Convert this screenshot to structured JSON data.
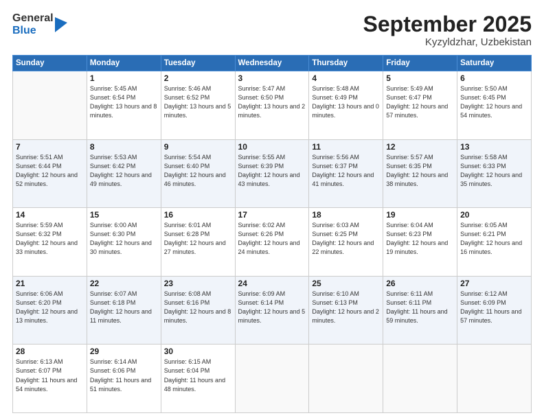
{
  "logo": {
    "general": "General",
    "blue": "Blue"
  },
  "header": {
    "month": "September 2025",
    "location": "Kyzyldzhar, Uzbekistan"
  },
  "weekdays": [
    "Sunday",
    "Monday",
    "Tuesday",
    "Wednesday",
    "Thursday",
    "Friday",
    "Saturday"
  ],
  "weeks": [
    [
      {
        "day": "",
        "sunrise": "",
        "sunset": "",
        "daylight": ""
      },
      {
        "day": "1",
        "sunrise": "Sunrise: 5:45 AM",
        "sunset": "Sunset: 6:54 PM",
        "daylight": "Daylight: 13 hours and 8 minutes."
      },
      {
        "day": "2",
        "sunrise": "Sunrise: 5:46 AM",
        "sunset": "Sunset: 6:52 PM",
        "daylight": "Daylight: 13 hours and 5 minutes."
      },
      {
        "day": "3",
        "sunrise": "Sunrise: 5:47 AM",
        "sunset": "Sunset: 6:50 PM",
        "daylight": "Daylight: 13 hours and 2 minutes."
      },
      {
        "day": "4",
        "sunrise": "Sunrise: 5:48 AM",
        "sunset": "Sunset: 6:49 PM",
        "daylight": "Daylight: 13 hours and 0 minutes."
      },
      {
        "day": "5",
        "sunrise": "Sunrise: 5:49 AM",
        "sunset": "Sunset: 6:47 PM",
        "daylight": "Daylight: 12 hours and 57 minutes."
      },
      {
        "day": "6",
        "sunrise": "Sunrise: 5:50 AM",
        "sunset": "Sunset: 6:45 PM",
        "daylight": "Daylight: 12 hours and 54 minutes."
      }
    ],
    [
      {
        "day": "7",
        "sunrise": "Sunrise: 5:51 AM",
        "sunset": "Sunset: 6:44 PM",
        "daylight": "Daylight: 12 hours and 52 minutes."
      },
      {
        "day": "8",
        "sunrise": "Sunrise: 5:53 AM",
        "sunset": "Sunset: 6:42 PM",
        "daylight": "Daylight: 12 hours and 49 minutes."
      },
      {
        "day": "9",
        "sunrise": "Sunrise: 5:54 AM",
        "sunset": "Sunset: 6:40 PM",
        "daylight": "Daylight: 12 hours and 46 minutes."
      },
      {
        "day": "10",
        "sunrise": "Sunrise: 5:55 AM",
        "sunset": "Sunset: 6:39 PM",
        "daylight": "Daylight: 12 hours and 43 minutes."
      },
      {
        "day": "11",
        "sunrise": "Sunrise: 5:56 AM",
        "sunset": "Sunset: 6:37 PM",
        "daylight": "Daylight: 12 hours and 41 minutes."
      },
      {
        "day": "12",
        "sunrise": "Sunrise: 5:57 AM",
        "sunset": "Sunset: 6:35 PM",
        "daylight": "Daylight: 12 hours and 38 minutes."
      },
      {
        "day": "13",
        "sunrise": "Sunrise: 5:58 AM",
        "sunset": "Sunset: 6:33 PM",
        "daylight": "Daylight: 12 hours and 35 minutes."
      }
    ],
    [
      {
        "day": "14",
        "sunrise": "Sunrise: 5:59 AM",
        "sunset": "Sunset: 6:32 PM",
        "daylight": "Daylight: 12 hours and 33 minutes."
      },
      {
        "day": "15",
        "sunrise": "Sunrise: 6:00 AM",
        "sunset": "Sunset: 6:30 PM",
        "daylight": "Daylight: 12 hours and 30 minutes."
      },
      {
        "day": "16",
        "sunrise": "Sunrise: 6:01 AM",
        "sunset": "Sunset: 6:28 PM",
        "daylight": "Daylight: 12 hours and 27 minutes."
      },
      {
        "day": "17",
        "sunrise": "Sunrise: 6:02 AM",
        "sunset": "Sunset: 6:26 PM",
        "daylight": "Daylight: 12 hours and 24 minutes."
      },
      {
        "day": "18",
        "sunrise": "Sunrise: 6:03 AM",
        "sunset": "Sunset: 6:25 PM",
        "daylight": "Daylight: 12 hours and 22 minutes."
      },
      {
        "day": "19",
        "sunrise": "Sunrise: 6:04 AM",
        "sunset": "Sunset: 6:23 PM",
        "daylight": "Daylight: 12 hours and 19 minutes."
      },
      {
        "day": "20",
        "sunrise": "Sunrise: 6:05 AM",
        "sunset": "Sunset: 6:21 PM",
        "daylight": "Daylight: 12 hours and 16 minutes."
      }
    ],
    [
      {
        "day": "21",
        "sunrise": "Sunrise: 6:06 AM",
        "sunset": "Sunset: 6:20 PM",
        "daylight": "Daylight: 12 hours and 13 minutes."
      },
      {
        "day": "22",
        "sunrise": "Sunrise: 6:07 AM",
        "sunset": "Sunset: 6:18 PM",
        "daylight": "Daylight: 12 hours and 11 minutes."
      },
      {
        "day": "23",
        "sunrise": "Sunrise: 6:08 AM",
        "sunset": "Sunset: 6:16 PM",
        "daylight": "Daylight: 12 hours and 8 minutes."
      },
      {
        "day": "24",
        "sunrise": "Sunrise: 6:09 AM",
        "sunset": "Sunset: 6:14 PM",
        "daylight": "Daylight: 12 hours and 5 minutes."
      },
      {
        "day": "25",
        "sunrise": "Sunrise: 6:10 AM",
        "sunset": "Sunset: 6:13 PM",
        "daylight": "Daylight: 12 hours and 2 minutes."
      },
      {
        "day": "26",
        "sunrise": "Sunrise: 6:11 AM",
        "sunset": "Sunset: 6:11 PM",
        "daylight": "Daylight: 11 hours and 59 minutes."
      },
      {
        "day": "27",
        "sunrise": "Sunrise: 6:12 AM",
        "sunset": "Sunset: 6:09 PM",
        "daylight": "Daylight: 11 hours and 57 minutes."
      }
    ],
    [
      {
        "day": "28",
        "sunrise": "Sunrise: 6:13 AM",
        "sunset": "Sunset: 6:07 PM",
        "daylight": "Daylight: 11 hours and 54 minutes."
      },
      {
        "day": "29",
        "sunrise": "Sunrise: 6:14 AM",
        "sunset": "Sunset: 6:06 PM",
        "daylight": "Daylight: 11 hours and 51 minutes."
      },
      {
        "day": "30",
        "sunrise": "Sunrise: 6:15 AM",
        "sunset": "Sunset: 6:04 PM",
        "daylight": "Daylight: 11 hours and 48 minutes."
      },
      {
        "day": "",
        "sunrise": "",
        "sunset": "",
        "daylight": ""
      },
      {
        "day": "",
        "sunrise": "",
        "sunset": "",
        "daylight": ""
      },
      {
        "day": "",
        "sunrise": "",
        "sunset": "",
        "daylight": ""
      },
      {
        "day": "",
        "sunrise": "",
        "sunset": "",
        "daylight": ""
      }
    ]
  ]
}
